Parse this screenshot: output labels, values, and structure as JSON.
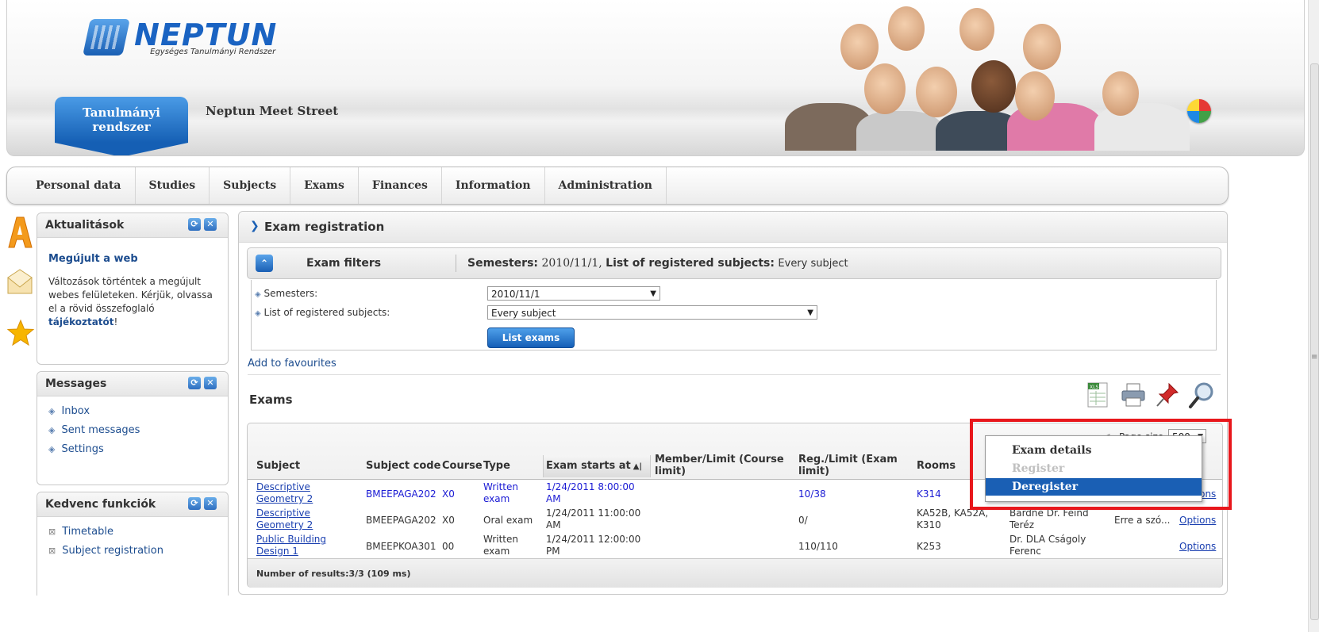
{
  "header": {
    "logo_title": "NEPTUN",
    "logo_subtitle": "Egységes Tanulmányi Rendszer",
    "active_tab": "Tanulmányi rendszer",
    "other_tab": "Neptun Meet Street"
  },
  "menu": [
    "Personal data",
    "Studies",
    "Subjects",
    "Exams",
    "Finances",
    "Information",
    "Administration"
  ],
  "sidebar": {
    "news": {
      "title": "Aktualitások",
      "headline": "Megújult a web",
      "body": "Változások történtek a megújult webes felületeken. Kérjük, olvassa el a rövid összefoglaló",
      "link": "tájékoztatót",
      "end": "!"
    },
    "messages": {
      "title": "Messages",
      "items": [
        "Inbox",
        "Sent messages",
        "Settings"
      ]
    },
    "favourites": {
      "title": "Kedvenc funkciók",
      "items": [
        "Timetable",
        "Subject registration"
      ]
    }
  },
  "main": {
    "title": "Exam registration",
    "filters": {
      "title": "Exam filters",
      "summary_sem_label": "Semesters:",
      "summary_sem_value": "2010/11/1,",
      "summary_subj_label": "List of registered subjects:",
      "summary_subj_value": "Every subject",
      "semesters_label": "Semesters:",
      "semesters_value": "2010/11/1",
      "subjects_label": "List of registered subjects:",
      "subjects_value": "Every subject",
      "button": "List exams"
    },
    "add_favourites": "Add to favourites",
    "exams_title": "Exams",
    "page_size_label": "Page size",
    "page_size_value": "500",
    "columns": [
      "Subject",
      "Subject code",
      "Course",
      "Type",
      "Exam starts at",
      "Member/Limit (Course limit)",
      "Reg./Limit (Exam limit)",
      "Rooms"
    ],
    "rows": [
      {
        "subject": "Descriptive Geometry 2",
        "code": "BMEEPAGA202",
        "course": "X0",
        "type": "Written exam",
        "starts": "1/24/2011 8:00:00 AM",
        "member": "",
        "reg": "10/38",
        "rooms": "K314",
        "examiner": "",
        "comment": "",
        "options": "Options"
      },
      {
        "subject": "Descriptive Geometry 2",
        "code": "BMEEPAGA202",
        "course": "X0",
        "type": "Oral exam",
        "starts": "1/24/2011 11:00:00 AM",
        "member": "",
        "reg": "0/",
        "rooms": "KA52B, KA52A, K310",
        "examiner": "Bardné Dr. Feind Teréz",
        "comment": "Erre a szó...",
        "options": "Options"
      },
      {
        "subject": "Public Building Design 1",
        "code": "BMEEPKOA301",
        "course": "00",
        "type": "Written exam",
        "starts": "1/24/2011 12:00:00 PM",
        "member": "",
        "reg": "110/110",
        "rooms": "K253",
        "examiner": "Dr. DLA Cságoly Ferenc",
        "comment": "",
        "options": "Options"
      }
    ],
    "results": "Number of results:3/3 (109 ms)"
  },
  "context_menu": {
    "items": [
      {
        "label": "Exam details",
        "state": "normal"
      },
      {
        "label": "Register",
        "state": "disabled"
      },
      {
        "label": "Deregister",
        "state": "selected"
      }
    ]
  },
  "colors": {
    "brand_blue": "#1a5fb4",
    "highlight": "#e8171c",
    "selected_bg": "#1a5fb4"
  }
}
